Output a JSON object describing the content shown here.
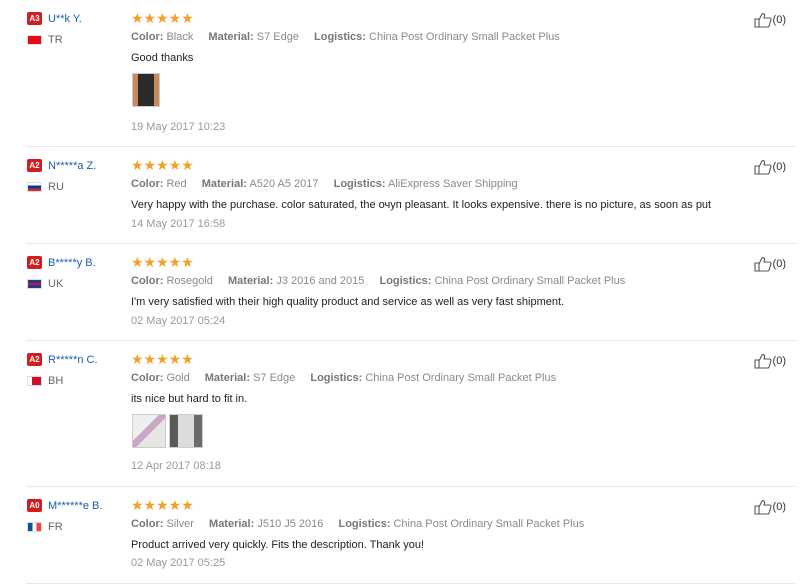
{
  "reviews": [
    {
      "level": "A3",
      "user": "U**k Y.",
      "country": "TR",
      "flag_color": "#e30a17",
      "stars": "★★★★★",
      "color_label": "Color:",
      "color": "Black",
      "material_label": "Material:",
      "material": "S7 Edge",
      "logistics_label": "Logistics:",
      "logistics": "China Post Ordinary Small Packet Plus",
      "text": "Good thanks",
      "date": "19 May 2017 10:23",
      "likes": "(0)"
    },
    {
      "level": "A2",
      "user": "N*****a Z.",
      "country": "RU",
      "flag_color": "#6a88d0",
      "stars": "★★★★★",
      "color_label": "Color:",
      "color": "Red",
      "material_label": "Material:",
      "material": "A520 A5 2017",
      "logistics_label": "Logistics:",
      "logistics": "AliExpress Saver Shipping",
      "text": "Very happy with the purchase. color saturated, the очуп pleasant. It looks expensive. there is no picture, as soon as put",
      "date": "14 May 2017 16:58",
      "likes": "(0)"
    },
    {
      "level": "A2",
      "user": "B*****y B.",
      "country": "UK",
      "flag_color": "#1f3d8a",
      "stars": "★★★★★",
      "color_label": "Color:",
      "color": "Rosegold",
      "material_label": "Material:",
      "material": "J3 2016 and 2015",
      "logistics_label": "Logistics:",
      "logistics": "China Post Ordinary Small Packet Plus",
      "text": "I'm very satisfied with their high quality product and service as well as very fast shipment.",
      "date": "02 May 2017 05:24",
      "likes": "(0)"
    },
    {
      "level": "A2",
      "user": "R*****n C.",
      "country": "BH",
      "flag_color": "#ce1126",
      "stars": "★★★★★",
      "color_label": "Color:",
      "color": "Gold",
      "material_label": "Material:",
      "material": "S7 Edge",
      "logistics_label": "Logistics:",
      "logistics": "China Post Ordinary Small Packet Plus",
      "text": "its nice but hard to fit in.",
      "date": "12 Apr 2017 08:18",
      "likes": "(0)"
    },
    {
      "level": "A0",
      "user": "M******e B.",
      "country": "FR",
      "flag_color": "#0055a4",
      "stars": "★★★★★",
      "color_label": "Color:",
      "color": "Silver",
      "material_label": "Material:",
      "material": "J510 J5 2016",
      "logistics_label": "Logistics:",
      "logistics": "China Post Ordinary Small Packet Plus",
      "text": "Product arrived very quickly. Fits the description. Thank you!",
      "date": "02 May 2017 05:25",
      "likes": "(0)"
    }
  ]
}
